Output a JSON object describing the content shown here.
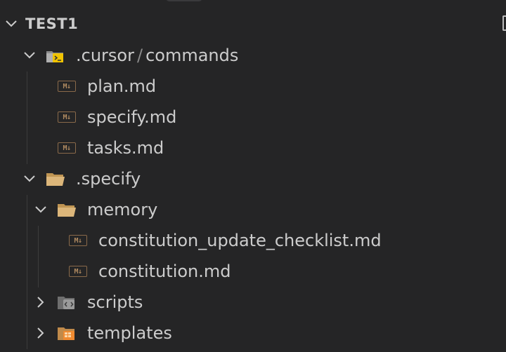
{
  "explorer": {
    "root": {
      "label": "TEST1",
      "expanded": true
    },
    "items": [
      {
        "name": ".cursor",
        "separator": "/",
        "name2": "commands",
        "type": "folder-special",
        "expanded": true
      },
      {
        "name": "plan.md",
        "type": "markdown"
      },
      {
        "name": "specify.md",
        "type": "markdown"
      },
      {
        "name": "tasks.md",
        "type": "markdown"
      },
      {
        "name": ".specify",
        "type": "folder",
        "expanded": true
      },
      {
        "name": "memory",
        "type": "folder",
        "expanded": true
      },
      {
        "name": "constitution_update_checklist.md",
        "type": "markdown"
      },
      {
        "name": "constitution.md",
        "type": "markdown"
      },
      {
        "name": "scripts",
        "type": "folder-scripts",
        "expanded": false
      },
      {
        "name": "templates",
        "type": "folder-templates",
        "expanded": false
      }
    ]
  },
  "colors": {
    "background": "#252526",
    "text": "#cccccc",
    "folder": "#dcb67a",
    "markdown_badge": "#8a6a4a"
  },
  "icons": {
    "chevron_open": "chevron-down-icon",
    "chevron_closed": "chevron-right-icon",
    "markdown": "markdown-icon",
    "folder": "folder-open-icon"
  }
}
